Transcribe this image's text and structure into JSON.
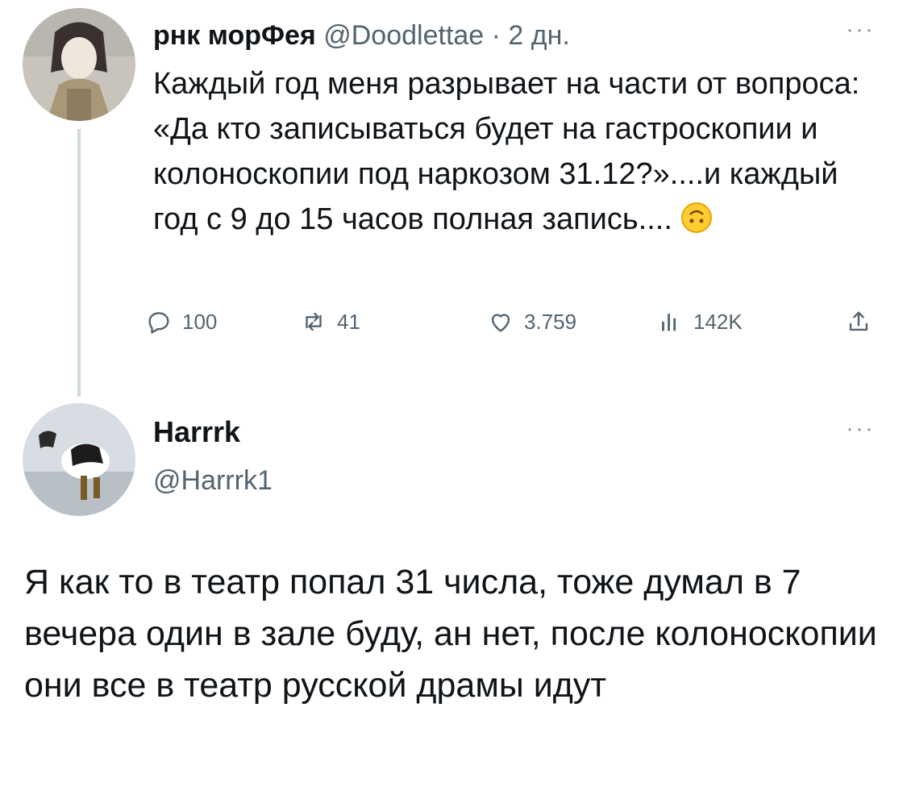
{
  "tweet_1": {
    "author_name": "рнк морФея",
    "meta": "@Doodlettae · 2 дн.",
    "more": "···",
    "text": "Каждый год меня разрывает на части от вопроса: «Да кто записываться будет на гастроскопии и колоноскопии под наркозом 31.12?»....и каждый год с 9 до 15 часов полная запись....",
    "emoji": "upside-down-face-emoji",
    "stats": {
      "replies": "100",
      "retweets": "41",
      "likes": "3.759",
      "views": "142K"
    },
    "icons": {
      "reply": "reply-icon",
      "retweet": "retweet-icon",
      "like": "heart-icon",
      "views": "views-chart-icon",
      "share": "share-icon"
    }
  },
  "tweet_2": {
    "author_name": "Harrrk",
    "handle": "@Harrrk1",
    "more": "···",
    "text": "Я как то в театр попал 31 числа, тоже думал в 7 вечера один в зале буду, ан нет, после колоноскопии они все в театр русской драмы идут"
  },
  "colors": {
    "text_primary": "#0f1419",
    "text_secondary": "#536471",
    "thread_line": "#cfd9de",
    "background": "#ffffff"
  }
}
